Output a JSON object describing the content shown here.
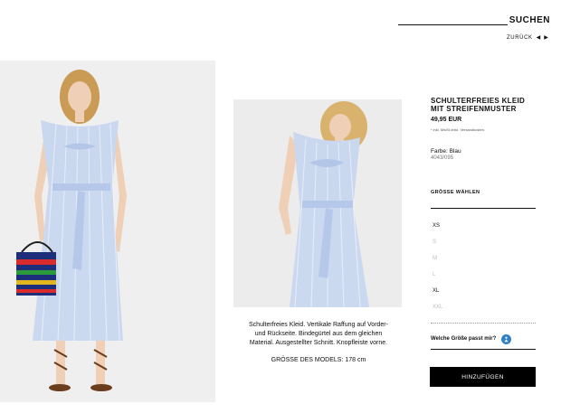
{
  "header": {
    "search_label": "SUCHEN",
    "back_label": "ZURÜCK",
    "prev_icon": "arrow-left-icon",
    "next_icon": "arrow-right-icon"
  },
  "product": {
    "title_line1": "SCHULTERFREIES KLEID",
    "title_line2": "MIT STREIFENMUSTER",
    "price": "49,95 EUR",
    "tax_note": "* inkl. MwSt./exkl. Versandkosten.",
    "color": "Farbe: Blau",
    "reference": "4043/095",
    "description_1": "Schulterfreies Kleid. Vertikale Raffung auf Vorder-",
    "description_2": "und Rückseite. Bindegürtel aus dem gleichen",
    "description_3": "Material. Ausgestellter Schnitt. Knopfleiste vorne.",
    "model_size": "GRÖSSE DES MODELS: 178 cm"
  },
  "size_selector": {
    "heading": "GRÖSSE WÄHLEN",
    "sizes": [
      {
        "label": "XS",
        "available": true
      },
      {
        "label": "S",
        "available": false
      },
      {
        "label": "M",
        "available": false
      },
      {
        "label": "L",
        "available": false
      },
      {
        "label": "XL",
        "available": true
      },
      {
        "label": "XXL",
        "available": false
      }
    ],
    "fit_label": "Welche Größe passt mir?",
    "fit_icon": "person-icon"
  },
  "add_button": "HINZUFÜGEN",
  "colors": {
    "dress": "#c9d7ef",
    "button": "#000000",
    "fit_icon": "#2f80c6"
  }
}
